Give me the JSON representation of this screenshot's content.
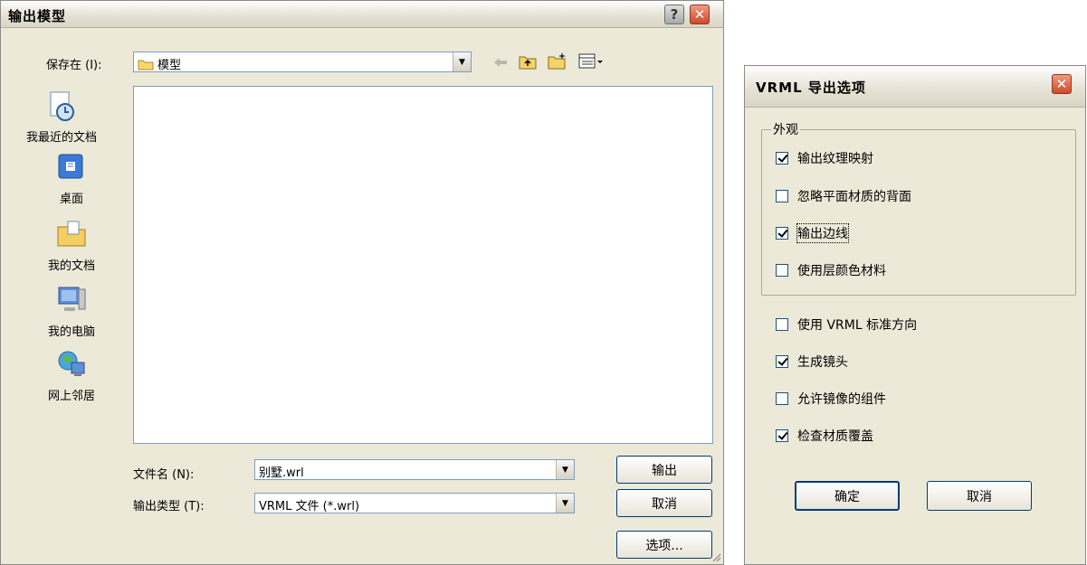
{
  "save_dialog": {
    "title": "输出模型",
    "save_in_label": "保存在 (I):",
    "save_in_value": "模型",
    "places": [
      {
        "label": "我最近的文档",
        "icon": "recent-docs-icon"
      },
      {
        "label": "桌面",
        "icon": "desktop-icon"
      },
      {
        "label": "我的文档",
        "icon": "my-documents-icon"
      },
      {
        "label": "我的电脑",
        "icon": "my-computer-icon"
      },
      {
        "label": "网上邻居",
        "icon": "network-places-icon"
      }
    ],
    "filename_label": "文件名 (N):",
    "filename_value": "别墅.wrl",
    "filetype_label": "输出类型 (T):",
    "filetype_value": "VRML 文件 (*.wrl)",
    "export_button": "输出",
    "cancel_button": "取消",
    "options_button": "选项..."
  },
  "vrml_dialog": {
    "title": "VRML 导出选项",
    "group_label": "外观",
    "group_options": [
      {
        "label": "输出纹理映射",
        "checked": true
      },
      {
        "label": "忽略平面材质的背面",
        "checked": false
      },
      {
        "label": "输出边线",
        "checked": true
      },
      {
        "label": "使用层颜色材料",
        "checked": false
      }
    ],
    "options": [
      {
        "label": "使用 VRML 标准方向",
        "checked": false
      },
      {
        "label": "生成镜头",
        "checked": true
      },
      {
        "label": "允许镜像的组件",
        "checked": false
      },
      {
        "label": "检查材质覆盖",
        "checked": true
      }
    ],
    "ok_button": "确定",
    "cancel_button": "取消"
  }
}
